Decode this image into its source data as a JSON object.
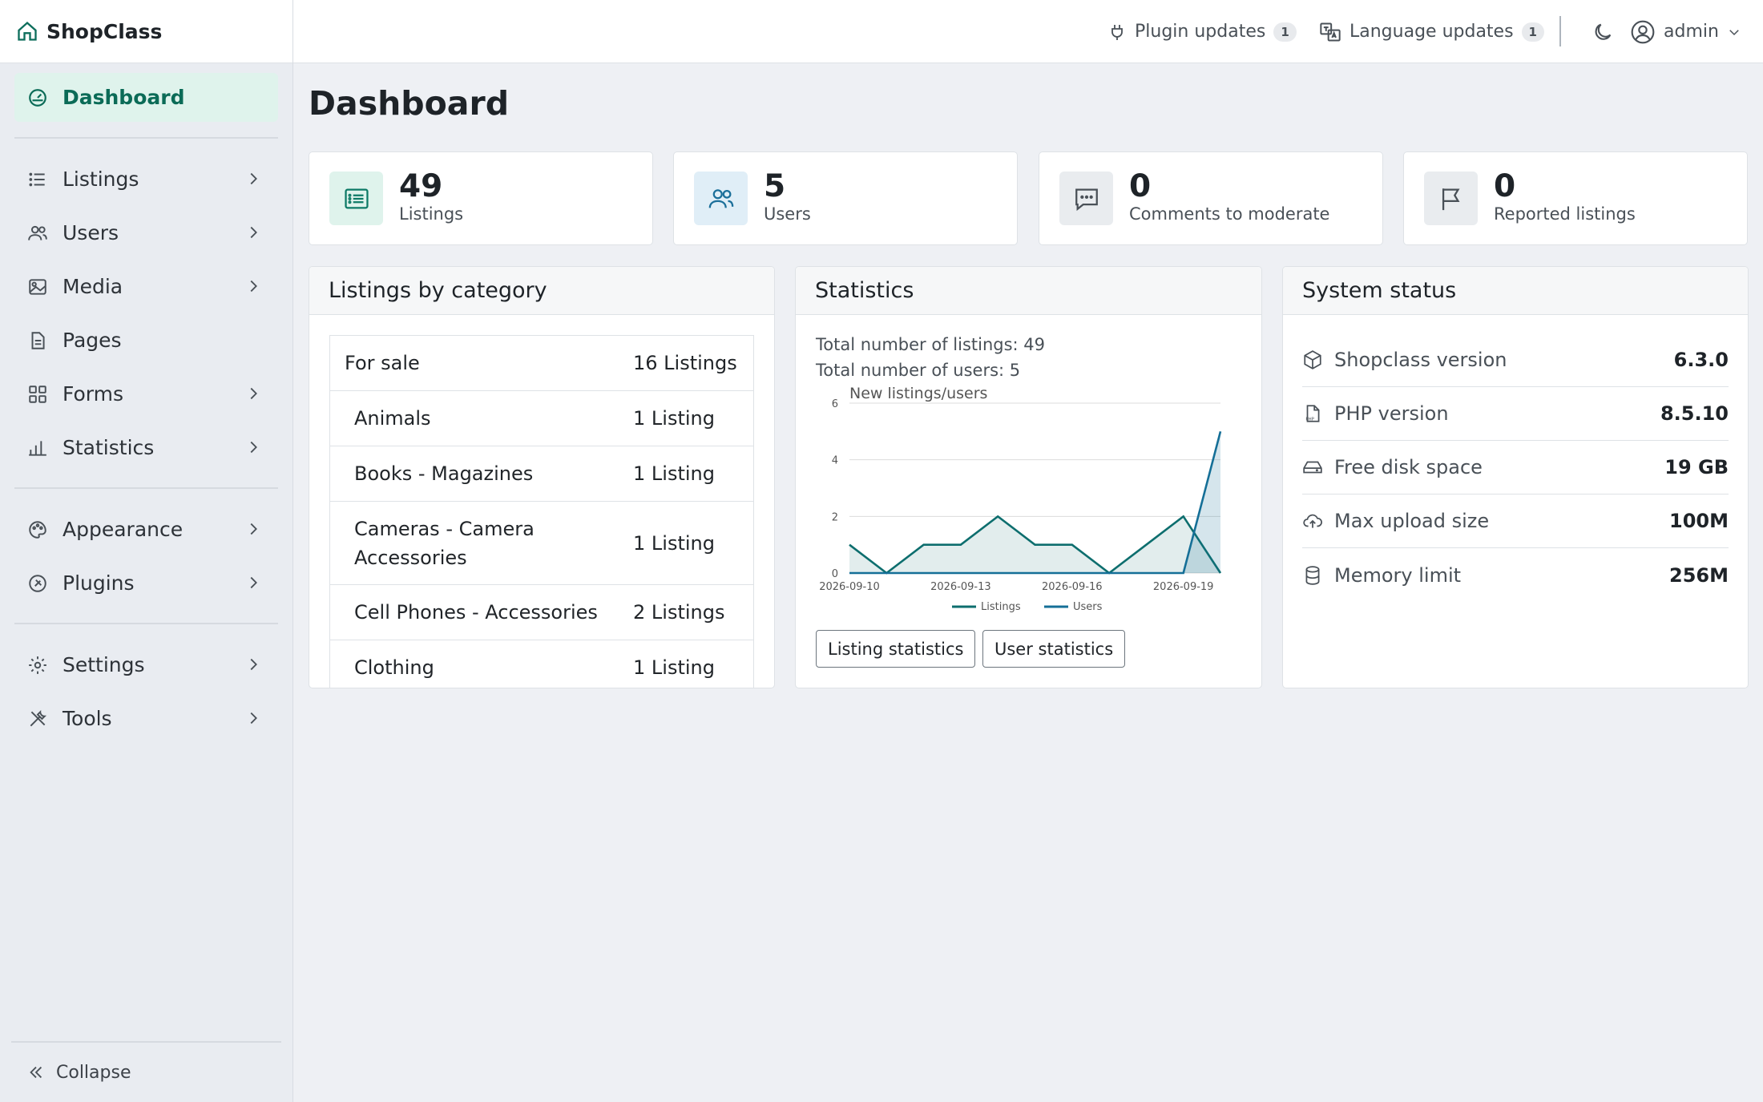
{
  "app": {
    "name": "ShopClass"
  },
  "sidebar": {
    "items": [
      {
        "label": "Dashboard",
        "icon": "gauge-icon"
      },
      {
        "label": "Listings",
        "icon": "list-icon"
      },
      {
        "label": "Users",
        "icon": "users-icon"
      },
      {
        "label": "Media",
        "icon": "image-icon"
      },
      {
        "label": "Pages",
        "icon": "file-icon"
      },
      {
        "label": "Forms",
        "icon": "grid-icon"
      },
      {
        "label": "Statistics",
        "icon": "bar-chart-icon"
      },
      {
        "label": "Appearance",
        "icon": "palette-icon"
      },
      {
        "label": "Plugins",
        "icon": "plugin-icon"
      },
      {
        "label": "Settings",
        "icon": "gear-icon"
      },
      {
        "label": "Tools",
        "icon": "tools-icon"
      }
    ],
    "collapse_label": "Collapse"
  },
  "topbar": {
    "plugin_updates": {
      "label": "Plugin updates",
      "count": "1"
    },
    "language_updates": {
      "label": "Language updates",
      "count": "1"
    },
    "user": "admin"
  },
  "page": {
    "title": "Dashboard"
  },
  "stats": [
    {
      "value": "49",
      "label": "Listings",
      "icon": "list-icon",
      "color": "#0d7a66",
      "bg": "#dff3ec"
    },
    {
      "value": "5",
      "label": "Users",
      "icon": "users-icon",
      "color": "#1b6f9a",
      "bg": "#e0eef7"
    },
    {
      "value": "0",
      "label": "Comments to moderate",
      "icon": "comment-icon",
      "color": "#495057",
      "bg": "#e9ecef"
    },
    {
      "value": "0",
      "label": "Reported listings",
      "icon": "flag-icon",
      "color": "#495057",
      "bg": "#e9ecef"
    }
  ],
  "categories": {
    "title": "Listings by category",
    "rows": [
      {
        "name": "For sale",
        "count": "16 Listings"
      },
      {
        "name": "Animals",
        "count": "1 Listing"
      },
      {
        "name": "Books - Magazines",
        "count": "1 Listing"
      },
      {
        "name": "Cameras - Camera Accessories",
        "count": "1 Listing"
      },
      {
        "name": "Cell Phones - Accessories",
        "count": "2 Listings"
      },
      {
        "name": "Clothing",
        "count": "1 Listing"
      }
    ]
  },
  "statistics": {
    "title": "Statistics",
    "total_listings": "Total number of listings: 49",
    "total_users": "Total number of users: 5",
    "listing_button": "Listing statistics",
    "user_button": "User statistics"
  },
  "chart_data": {
    "type": "area",
    "title": "New listings/users",
    "x": [
      "2026-09-10",
      "2026-09-11",
      "2026-09-12",
      "2026-09-13",
      "2026-09-14",
      "2026-09-15",
      "2026-09-16",
      "2026-09-17",
      "2026-09-18",
      "2026-09-19",
      "2026-09-20"
    ],
    "x_tick_labels": [
      "2026-09-10",
      "2026-09-13",
      "2026-09-16",
      "2026-09-19"
    ],
    "series": [
      {
        "name": "Listings",
        "values": [
          1,
          0,
          1,
          1,
          2,
          1,
          1,
          0,
          1,
          2,
          0
        ],
        "color": "#0d6e6e"
      },
      {
        "name": "Users",
        "values": [
          0,
          0,
          0,
          0,
          0,
          0,
          0,
          0,
          0,
          0,
          5
        ],
        "color": "#156f97"
      }
    ],
    "ylim": [
      0,
      6
    ],
    "yticks": [
      "0",
      "2",
      "4",
      "6"
    ],
    "grid": true,
    "legend": "bottom"
  },
  "system": {
    "title": "System status",
    "rows": [
      {
        "label": "Shopclass version",
        "value": "6.3.0",
        "icon": "box-icon"
      },
      {
        "label": "PHP version",
        "value": "8.5.10",
        "icon": "php-file-icon"
      },
      {
        "label": "Free disk space",
        "value": "19 GB",
        "icon": "hard-drive-icon"
      },
      {
        "label": "Max upload size",
        "value": "100M",
        "icon": "cloud-upload-icon"
      },
      {
        "label": "Memory limit",
        "value": "256M",
        "icon": "database-icon"
      }
    ]
  }
}
